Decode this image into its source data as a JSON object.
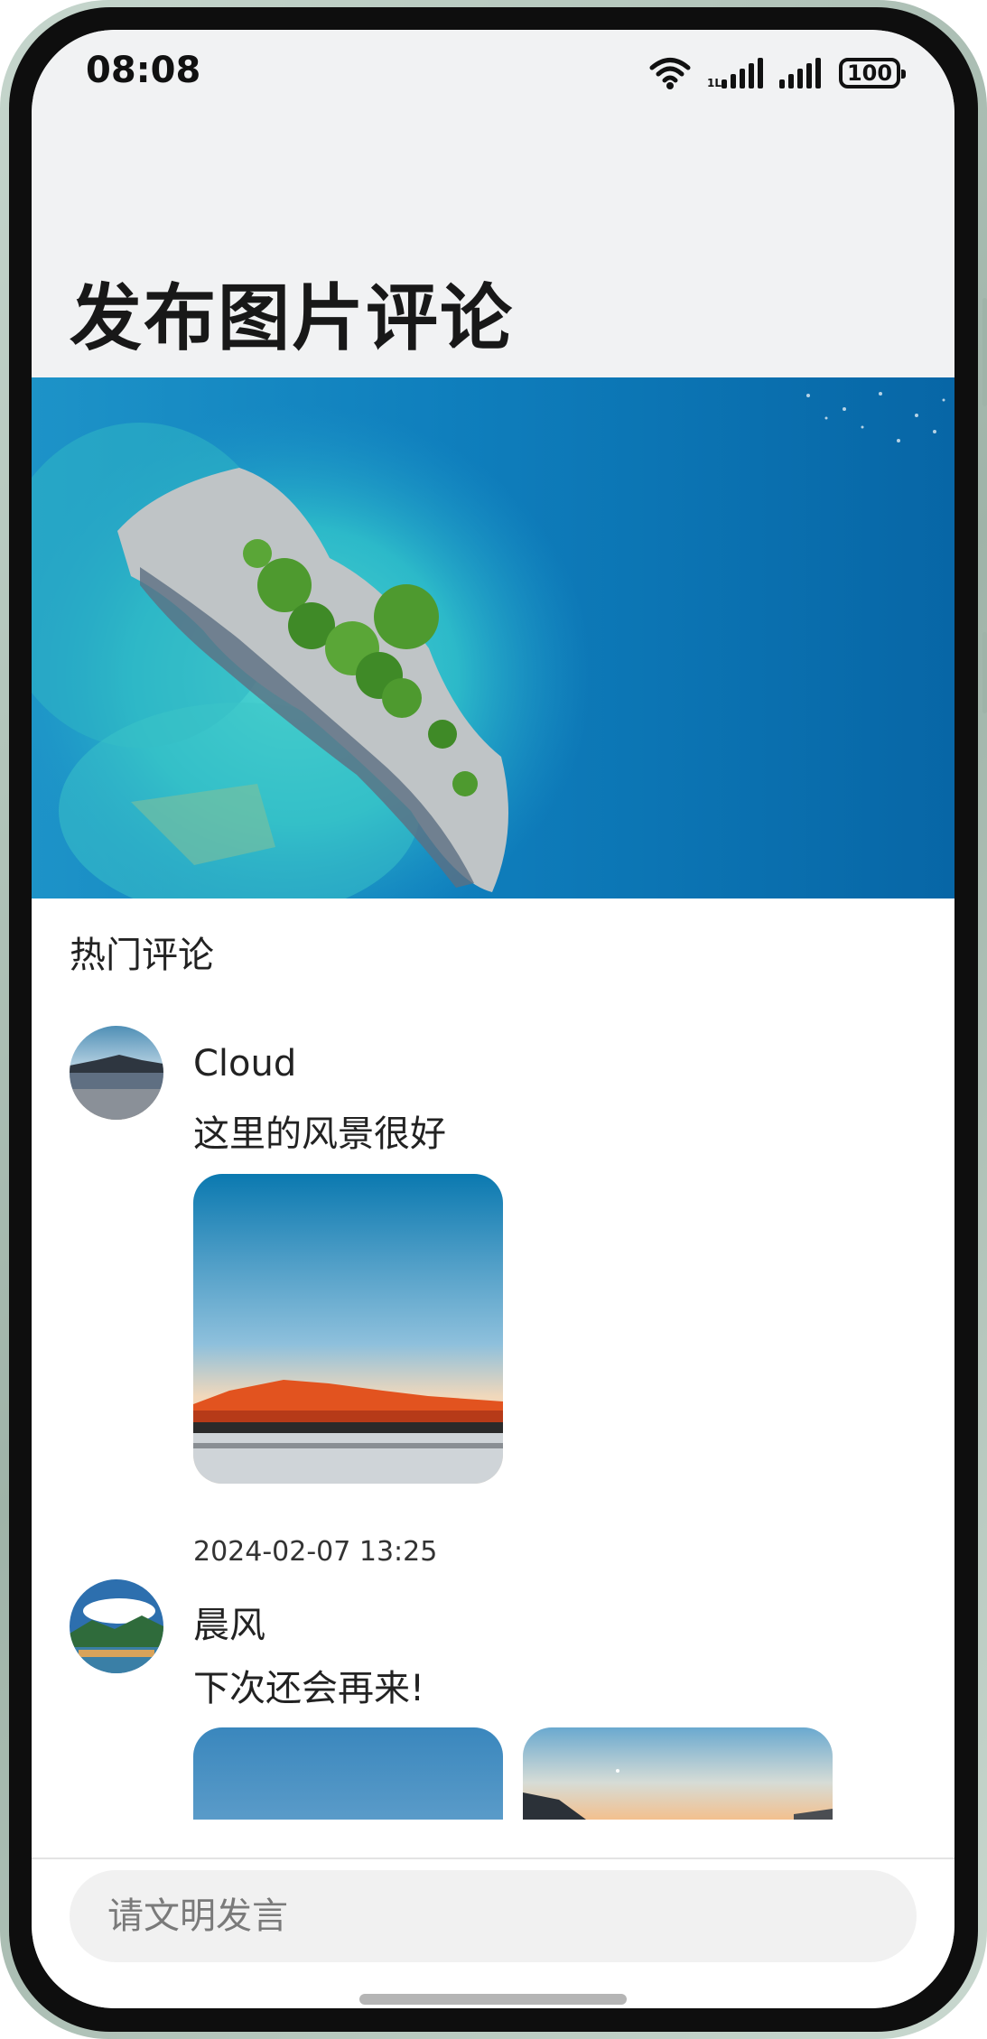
{
  "status_bar": {
    "time": "08:08",
    "battery": "100",
    "icons": [
      "wifi-icon",
      "signal-icon",
      "signal-icon",
      "battery-icon"
    ]
  },
  "header": {
    "title": "发布图片评论"
  },
  "comments_section": {
    "title": "热门评论",
    "comments": [
      {
        "user": "Cloud",
        "text": "这里的风景很好",
        "time": "2024-02-07 13:25"
      },
      {
        "user": "晨风",
        "text": "下次还会再来!"
      }
    ]
  },
  "composer": {
    "placeholder": "请文明发言"
  },
  "colors": {
    "header_bg": "#f1f2f3",
    "input_bg": "#f1f1f1",
    "ocean": "#0a6fae"
  }
}
